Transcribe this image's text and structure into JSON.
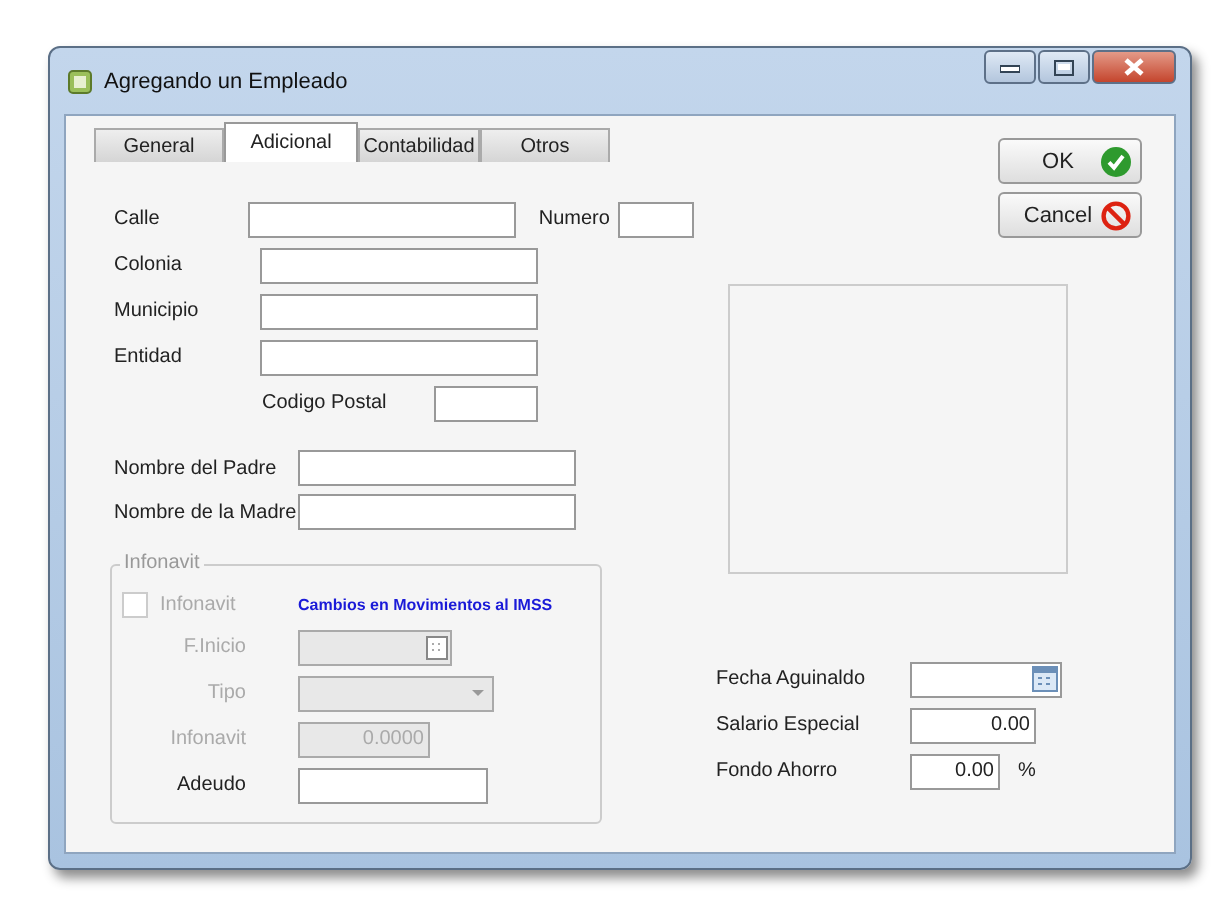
{
  "window": {
    "title": "Agregando un Empleado"
  },
  "tabs": [
    {
      "label": "General",
      "selected": false
    },
    {
      "label": "Adicional",
      "selected": true
    },
    {
      "label": "Contabilidad",
      "selected": false
    },
    {
      "label": "Otros",
      "selected": false
    }
  ],
  "buttons": [
    {
      "label": "OK",
      "kind": "ok"
    },
    {
      "label": "Cancel",
      "kind": "cancel"
    }
  ],
  "address": {
    "calle": {
      "label": "Calle"
    },
    "numero": {
      "label": "Numero"
    },
    "colonia": {
      "label": "Colonia"
    },
    "municipio": {
      "label": "Municipio"
    },
    "entidad": {
      "label": "Entidad"
    },
    "codigo_postal": {
      "label": "Codigo Postal"
    }
  },
  "padres": [
    {
      "label": "Nombre del Padre"
    },
    {
      "label": "Nombre de la Madre"
    }
  ],
  "infonavit": {
    "title": "Infonavit",
    "checkbox": {
      "label": "Infonavit",
      "checked": false,
      "disabled": true
    },
    "link": "Cambios en Movimientos al IMSS",
    "fields": [
      {
        "label": "F.Inicio",
        "kind": "date",
        "disabled": true
      },
      {
        "label": "Tipo",
        "kind": "combo",
        "disabled": true
      },
      {
        "label": "Infonavit",
        "kind": "text",
        "value": "0.0000",
        "disabled": true
      },
      {
        "label": "Adeudo",
        "kind": "text",
        "disabled": false
      }
    ]
  },
  "extras": [
    {
      "label": "Fecha Aguinaldo",
      "kind": "date"
    },
    {
      "label": "Salario Especial",
      "kind": "text",
      "value": "0.00"
    },
    {
      "label": "Fondo Ahorro",
      "kind": "percent",
      "value": "0.00",
      "unit": "%"
    }
  ]
}
